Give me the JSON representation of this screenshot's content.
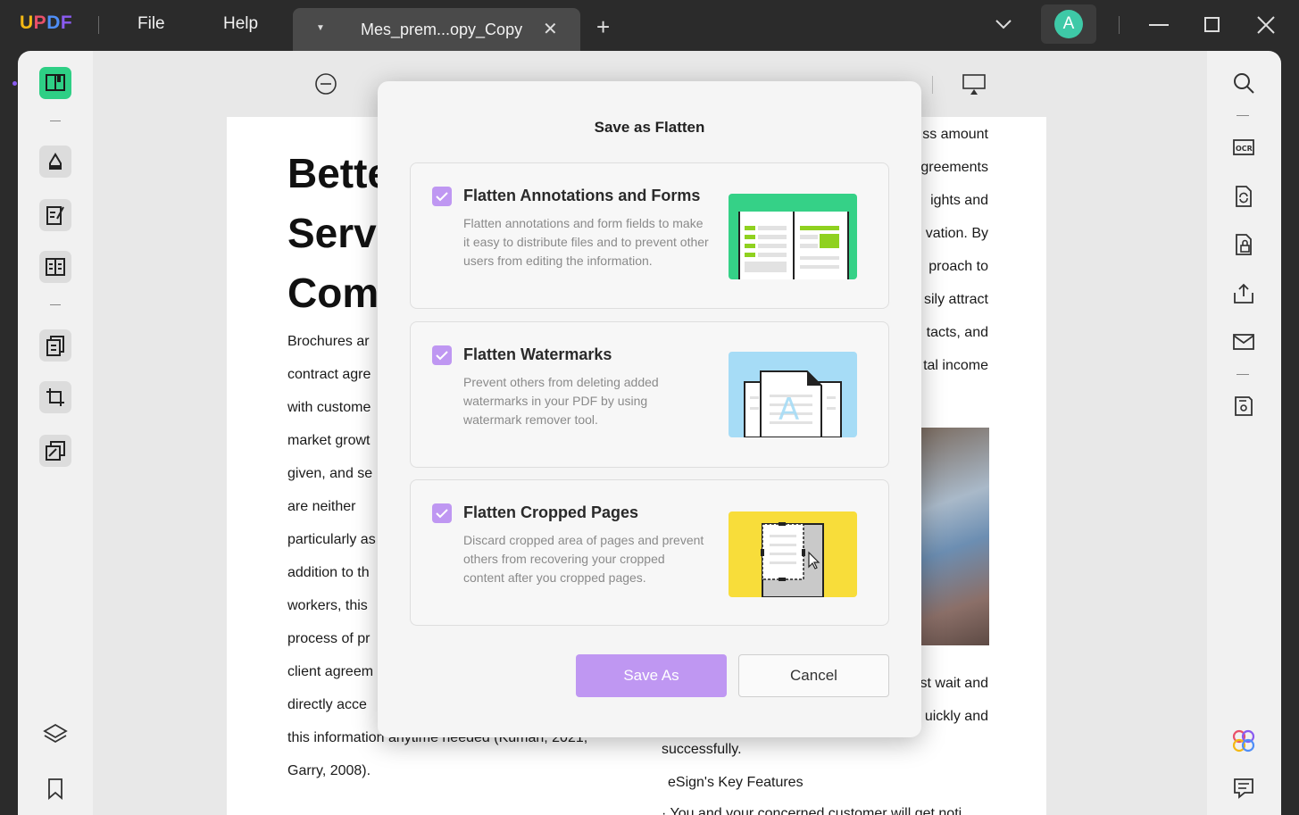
{
  "titlebar": {
    "logo": {
      "u": "U",
      "p": "P",
      "d": "D",
      "f": "F"
    },
    "menu": {
      "file": "File",
      "help": "Help"
    },
    "tab": {
      "title": "Mes_prem...opy_Copy"
    },
    "avatar_initial": "A"
  },
  "colors": {
    "accent": "#bf97f2",
    "sidebar_active": "#2ecf85",
    "avatar": "#3ec9a7"
  },
  "icons": {
    "left": [
      "reader-icon",
      "highlighter-icon",
      "edit-text-icon",
      "form-icon",
      "organize-pages-icon",
      "crop-icon",
      "redact-icon",
      "layers-icon",
      "bookmark-icon"
    ],
    "right": [
      "search-icon",
      "ocr-icon",
      "convert-icon",
      "protect-icon",
      "share-icon",
      "email-icon",
      "save-icon",
      "ai-assistant-icon",
      "comment-list-icon"
    ]
  },
  "document": {
    "title_lines": [
      "Bette",
      "Servi",
      "Com"
    ],
    "left_lines": [
      "Brochures ar",
      "contract agre",
      "with custome",
      "market growt",
      "given, and se",
      "are   neither",
      "particularly as",
      "addition to th",
      "workers, this",
      "process of pr",
      "client agreem",
      "directly acce",
      "this information anytime needed (Kumari, 2021;",
      "Garry, 2008)."
    ],
    "right_lines": [
      "ss amount",
      "greements",
      "ights  and",
      "vation.  By",
      "proach   to",
      "sily attract",
      "tacts, and",
      "tal income"
    ],
    "right_lower": [
      "st wait and",
      "uickly and",
      "successfully.",
      "eSign's Key Features",
      "· You and your concerned customer will get noti"
    ]
  },
  "dialog": {
    "title": "Save as Flatten",
    "options": [
      {
        "title": "Flatten Annotations and Forms",
        "description": "Flatten annotations and form fields to make it easy to distribute files and to prevent other users from editing the information.",
        "checked": true
      },
      {
        "title": "Flatten Watermarks",
        "description": "Prevent others from deleting added watermarks in your PDF by using watermark remover tool.",
        "checked": true
      },
      {
        "title": "Flatten Cropped Pages",
        "description": "Discard cropped area of pages and prevent others from recovering your cropped content after you cropped pages.",
        "checked": true
      }
    ],
    "save_label": "Save As",
    "cancel_label": "Cancel"
  }
}
